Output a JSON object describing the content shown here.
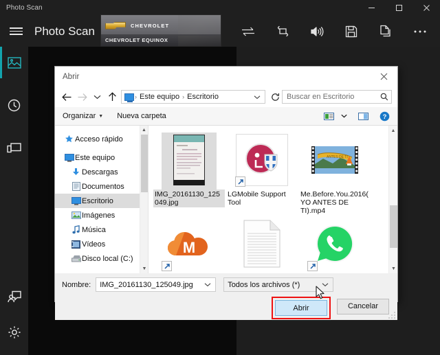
{
  "window": {
    "title": "Photo Scan",
    "controls": [
      {
        "name": "minimize",
        "glyph": "minimize-icon"
      },
      {
        "name": "maximize",
        "glyph": "maximize-icon"
      },
      {
        "name": "close",
        "glyph": "close-icon"
      }
    ]
  },
  "app": {
    "name": "Photo Scan",
    "menu_label": "menu",
    "banner": {
      "brand": "CHEVROLET",
      "model": "CHEVROLET EQUINOX"
    },
    "tools": [
      {
        "name": "transfer-icon",
        "label": "Transfer"
      },
      {
        "name": "rotate-icon",
        "label": "Rotate"
      },
      {
        "name": "volume-icon",
        "label": "Volume"
      },
      {
        "name": "save-icon",
        "label": "Save"
      },
      {
        "name": "copy-icon",
        "label": "Copy"
      },
      {
        "name": "more-icon",
        "label": "More"
      }
    ],
    "rail": [
      {
        "name": "photos-icon",
        "label": "Photos",
        "active": true
      },
      {
        "name": "history-icon",
        "label": "History",
        "active": false
      },
      {
        "name": "devices-icon",
        "label": "Devices",
        "active": false
      },
      {
        "name": "feedback-icon",
        "label": "Feedback",
        "active": false
      },
      {
        "name": "settings-icon",
        "label": "Settings",
        "active": false
      }
    ]
  },
  "dialog": {
    "title": "Abrir",
    "close_label": "Cerrar",
    "nav": {
      "back_label": "Atras",
      "forward_label": "Adelante",
      "recent_label": "Ubicaciones recientes",
      "up_label": "Subir un nivel",
      "breadcrumbs": [
        "Este equipo",
        "Escritorio"
      ],
      "separator": "›",
      "refresh_label": "Actualizar"
    },
    "search": {
      "placeholder": "Buscar en Escritorio"
    },
    "commands": {
      "organize": "Organizar",
      "new_folder": "Nueva carpeta",
      "view_label": "Cambiar la vista",
      "preview_label": "Mostrar el panel de vista previa",
      "help_label": "Obtener ayuda"
    },
    "tree": [
      {
        "label": "Acceso rápido",
        "icon": "star-icon",
        "indent": false,
        "selected": false
      },
      {
        "label": "Este equipo",
        "icon": "computer-icon",
        "indent": false,
        "selected": false
      },
      {
        "label": "Descargas",
        "icon": "download-icon",
        "indent": true,
        "selected": false
      },
      {
        "label": "Documentos",
        "icon": "documents-icon",
        "indent": true,
        "selected": false
      },
      {
        "label": "Escritorio",
        "icon": "desktop-icon",
        "indent": true,
        "selected": true
      },
      {
        "label": "Imágenes",
        "icon": "pictures-icon",
        "indent": true,
        "selected": false
      },
      {
        "label": "Música",
        "icon": "music-icon",
        "indent": true,
        "selected": false
      },
      {
        "label": "Vídeos",
        "icon": "videos-icon",
        "indent": true,
        "selected": false
      },
      {
        "label": "Disco local (C:)",
        "icon": "drive-icon",
        "indent": true,
        "selected": false
      }
    ],
    "files": [
      {
        "label": "IMG_20161130_125049.jpg",
        "kind": "photo",
        "selected": true,
        "shortcut": false
      },
      {
        "label": "LGMobile Support Tool",
        "kind": "lg-tool",
        "selected": false,
        "shortcut": true
      },
      {
        "label": "Me.Before.You.2016(YO ANTES DE TI).mp4",
        "kind": "video",
        "selected": false,
        "shortcut": false
      },
      {
        "label": "",
        "kind": "mega",
        "selected": false,
        "shortcut": true
      },
      {
        "label": "",
        "kind": "document",
        "selected": false,
        "shortcut": false
      },
      {
        "label": "",
        "kind": "whatsapp",
        "selected": false,
        "shortcut": true
      }
    ],
    "footer": {
      "name_label": "Nombre:",
      "name_value": "IMG_20161130_125049.jpg",
      "filter_value": "Todos los archivos (*)",
      "open_button": "Abrir",
      "cancel_button": "Cancelar"
    }
  },
  "colors": {
    "accent_teal": "#13a3ad",
    "app_chrome": "#1f1f1f",
    "canvas": "#0c0c0c",
    "highlight_red": "#ee1111",
    "selection_gray": "#dcdcdc",
    "primary_button": "#cfe8f9"
  }
}
